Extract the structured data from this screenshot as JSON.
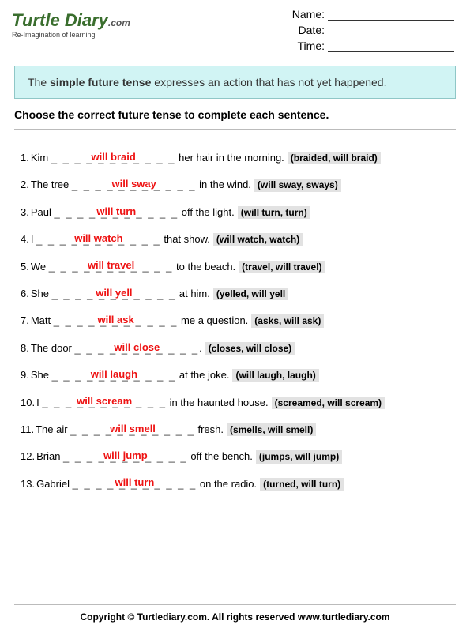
{
  "logo": {
    "title_main": "Turtle Diary",
    "dotcom": ".com",
    "tagline": "Re-Imagination of learning"
  },
  "meta": {
    "name_label": "Name:",
    "date_label": "Date:",
    "time_label": "Time:"
  },
  "info": {
    "pre": "The ",
    "bold": "simple future tense",
    "post": " expresses an action that has not yet happened."
  },
  "instruction": "Choose the correct future tense to complete each sentence.",
  "dashes": "_ _ _ _ _ _ _ _ _ _ _",
  "questions": [
    {
      "n": "1.",
      "before": "Kim ",
      "answer": "will braid",
      "after": " her hair in the morning.",
      "options": "(braided, will braid)"
    },
    {
      "n": "2.",
      "before": "The tree ",
      "answer": "will sway",
      "after": " in the wind.",
      "options": "(will sway, sways)"
    },
    {
      "n": "3.",
      "before": "Paul ",
      "answer": "will turn",
      "after": " off the light.",
      "options": "(will turn, turn)"
    },
    {
      "n": "4.",
      "before": "I ",
      "answer": "will watch",
      "after": " that show.",
      "options": "(will watch, watch)"
    },
    {
      "n": "5.",
      "before": "We ",
      "answer": "will travel",
      "after": " to the beach.",
      "options": "(travel, will travel)"
    },
    {
      "n": "6.",
      "before": "She ",
      "answer": "will yell",
      "after": " at him.",
      "options": "(yelled, will yell"
    },
    {
      "n": "7.",
      "before": "Matt ",
      "answer": "will ask",
      "after": " me a question.",
      "options": "(asks, will ask)"
    },
    {
      "n": "8.",
      "before": "The door ",
      "answer": "will close",
      "after": ".",
      "options": "(closes, will close)"
    },
    {
      "n": "9.",
      "before": "She ",
      "answer": "will laugh",
      "after": " at the joke.",
      "options": "(will laugh, laugh)"
    },
    {
      "n": "10.",
      "before": "I ",
      "answer": "will scream",
      "after": " in the haunted house.",
      "options": "(screamed, will scream)"
    },
    {
      "n": "11.",
      "before": "The air ",
      "answer": "will smell",
      "after": " fresh.",
      "options": "(smells, will smell)"
    },
    {
      "n": "12.",
      "before": "Brian ",
      "answer": "will jump",
      "after": " off the bench.",
      "options": "(jumps, will jump)"
    },
    {
      "n": "13.",
      "before": "Gabriel ",
      "answer": "will turn",
      "after": " on the radio.",
      "options": "(turned, will turn)"
    }
  ],
  "footer": "Copyright © Turtlediary.com. All rights reserved   www.turtlediary.com"
}
